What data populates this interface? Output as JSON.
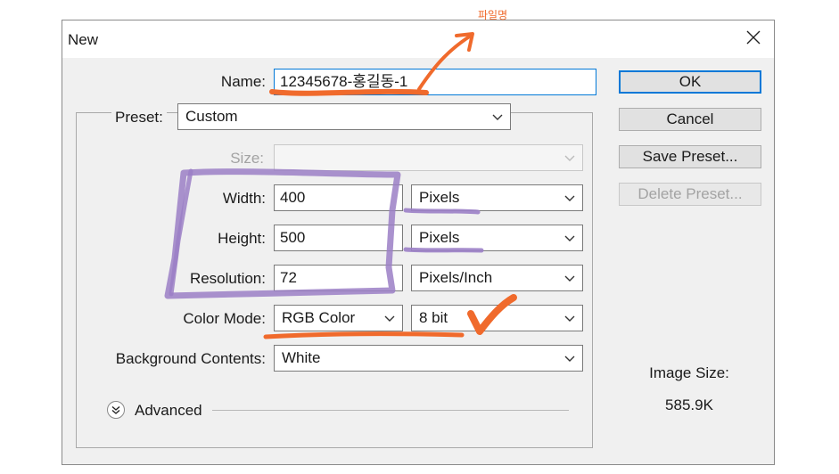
{
  "dialog": {
    "title": "New"
  },
  "form": {
    "name_label": "Name:",
    "name_value": "12345678-홍길동-1",
    "preset_label": "Preset:",
    "preset_value": "Custom",
    "size_label": "Size:",
    "size_value": "",
    "width_label": "Width:",
    "width_value": "400",
    "width_unit": "Pixels",
    "height_label": "Height:",
    "height_value": "500",
    "height_unit": "Pixels",
    "resolution_label": "Resolution:",
    "resolution_value": "72",
    "resolution_unit": "Pixels/Inch",
    "color_mode_label": "Color Mode:",
    "color_mode_value": "RGB Color",
    "bit_depth_value": "8 bit",
    "background_label": "Background Contents:",
    "background_value": "White",
    "advanced_label": "Advanced"
  },
  "buttons": {
    "ok": "OK",
    "cancel": "Cancel",
    "save_preset": "Save Preset...",
    "delete_preset": "Delete Preset..."
  },
  "image_size": {
    "label": "Image Size:",
    "value": "585.9K"
  },
  "annotation": {
    "text": "파일명",
    "colors": {
      "orange": "#f06a2c",
      "purple": "#9b7fc6",
      "accent": "#0078d7"
    }
  }
}
